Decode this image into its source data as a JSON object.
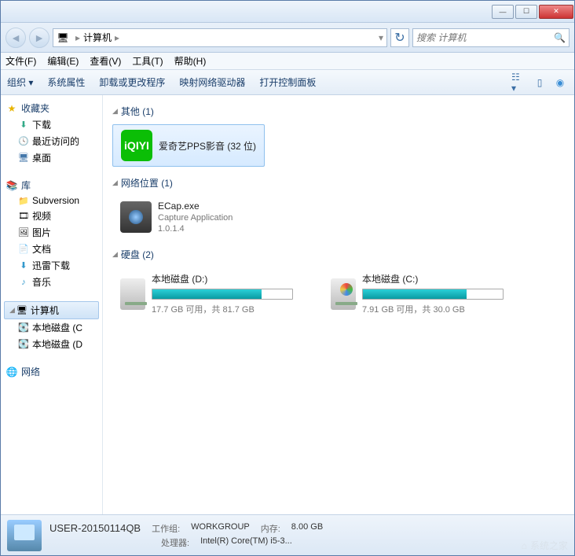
{
  "titlebar": {
    "min": "—",
    "max": "☐",
    "close": "✕"
  },
  "nav": {
    "breadcrumb_root": "计算机",
    "search_placeholder": "搜索 计算机"
  },
  "menubar": {
    "file": "文件(F)",
    "edit": "编辑(E)",
    "view": "查看(V)",
    "tools": "工具(T)",
    "help": "帮助(H)"
  },
  "toolbar": {
    "organize": "组织",
    "sys_props": "系统属性",
    "uninstall": "卸载或更改程序",
    "map_drive": "映射网络驱动器",
    "control_panel": "打开控制面板"
  },
  "sidebar": {
    "favorites": {
      "label": "收藏夹",
      "items": [
        "下载",
        "最近访问的",
        "桌面"
      ]
    },
    "libraries": {
      "label": "库",
      "items": [
        "Subversion",
        "视频",
        "图片",
        "文档",
        "迅雷下载",
        "音乐"
      ]
    },
    "computer": {
      "label": "计算机",
      "items": [
        "本地磁盘 (C",
        "本地磁盘 (D"
      ]
    },
    "network": {
      "label": "网络"
    }
  },
  "content": {
    "groups": {
      "other": {
        "label": "其他 (1)"
      },
      "netloc": {
        "label": "网络位置 (1)"
      },
      "disks": {
        "label": "硬盘 (2)"
      }
    },
    "iqiyi": {
      "title": "爱奇艺PPS影音 (32 位)"
    },
    "ecap": {
      "title": "ECap.exe",
      "sub1": "Capture Application",
      "sub2": "1.0.1.4"
    },
    "drive_d": {
      "title": "本地磁盘 (D:)",
      "info": "17.7 GB 可用，共 81.7 GB",
      "used_pct": 78
    },
    "drive_c": {
      "title": "本地磁盘 (C:)",
      "info": "7.91 GB 可用，共 30.0 GB",
      "used_pct": 74
    }
  },
  "status": {
    "name": "USER-20150114QB",
    "workgroup_label": "工作组:",
    "workgroup": "WORKGROUP",
    "mem_label": "内存:",
    "mem": "8.00 GB",
    "cpu_label": "处理器:",
    "cpu": "Intel(R) Core(TM) i5-3...",
    "watermark": "系统之家"
  }
}
